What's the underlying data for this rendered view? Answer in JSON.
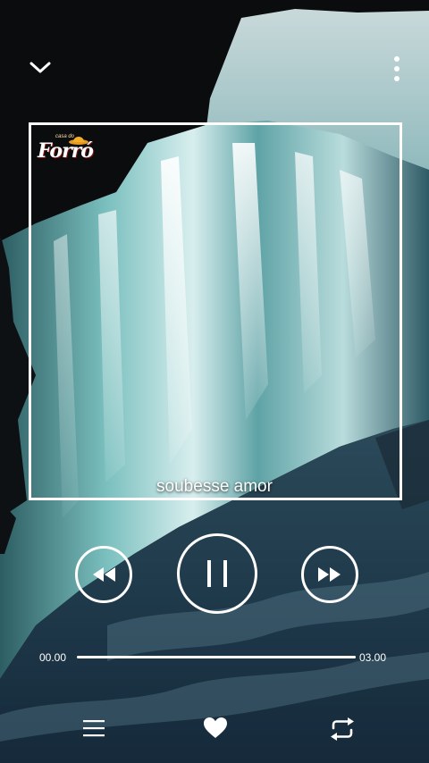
{
  "player": {
    "lyric": "soubesse amor",
    "time_current": "00.00",
    "time_total": "03.00",
    "progress": 1.0
  },
  "logo": {
    "small_text": "casa do",
    "brand_text": "Forró"
  },
  "icons": {
    "collapse": "chevron-down-icon",
    "more": "more-vertical-icon",
    "previous": "rewind-icon",
    "pause": "pause-icon",
    "next": "fast-forward-icon",
    "playlist": "menu-icon",
    "favorite": "heart-icon",
    "repeat": "repeat-icon"
  },
  "colors": {
    "accent": "#ffffff",
    "background": "#0b0c0e",
    "water_light": "#7fc3c4",
    "water_dark": "#1e3846"
  }
}
